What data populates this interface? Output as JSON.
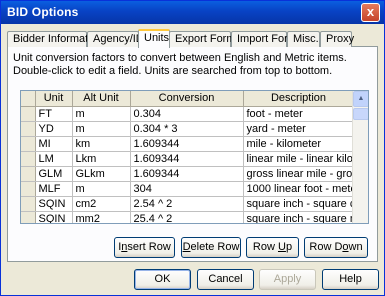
{
  "window": {
    "title": "BID Options",
    "close_glyph": "x"
  },
  "tabs": [
    {
      "label": "Bidder Information"
    },
    {
      "label": "Agency/ID"
    },
    {
      "label": "Units"
    },
    {
      "label": "Export Format"
    },
    {
      "label": "Import Format"
    },
    {
      "label": "Misc."
    },
    {
      "label": "Proxy"
    }
  ],
  "description": "Unit conversion factors to convert between English and Metric items.  Double-click to edit a field.  Units are searched from top to bottom.",
  "table": {
    "headers": [
      "Unit",
      "Alt Unit",
      "Conversion",
      "Description"
    ],
    "rows": [
      {
        "unit": "FT",
        "alt": "m",
        "conv": "0.304",
        "desc": "foot - meter"
      },
      {
        "unit": "YD",
        "alt": "m",
        "conv": "0.304 * 3",
        "desc": "yard - meter"
      },
      {
        "unit": "MI",
        "alt": "km",
        "conv": "1.609344",
        "desc": "mile - kilometer"
      },
      {
        "unit": "LM",
        "alt": "Lkm",
        "conv": "1.609344",
        "desc": "linear mile - linear kilometer"
      },
      {
        "unit": "GLM",
        "alt": "GLkm",
        "conv": "1.609344",
        "desc": "gross linear mile - gross linear kilo"
      },
      {
        "unit": "MLF",
        "alt": "m",
        "conv": "304",
        "desc": "1000 linear foot - meter"
      },
      {
        "unit": "SQIN",
        "alt": "cm2",
        "conv": "2.54 ^ 2",
        "desc": "square inch - square centimeter"
      },
      {
        "unit": "SQIN",
        "alt": "mm2",
        "conv": "25.4 ^ 2",
        "desc": "square inch - square millimeter"
      }
    ]
  },
  "actions": {
    "insert_row": {
      "pre": "I",
      "mnemonic": "n",
      "post": "sert Row"
    },
    "delete_row": {
      "pre": "",
      "mnemonic": "D",
      "post": "elete Row"
    },
    "row_up": {
      "pre": "Row ",
      "mnemonic": "U",
      "post": "p"
    },
    "row_down": {
      "pre": "Row D",
      "mnemonic": "o",
      "post": "wn"
    }
  },
  "footer": {
    "ok": "OK",
    "cancel": "Cancel",
    "apply": "Apply",
    "help": "Help"
  },
  "colors": {
    "titlebar": "#0842c4",
    "active_tab_highlight": "#ffc83c",
    "dialog_bg": "#ece9d8"
  }
}
